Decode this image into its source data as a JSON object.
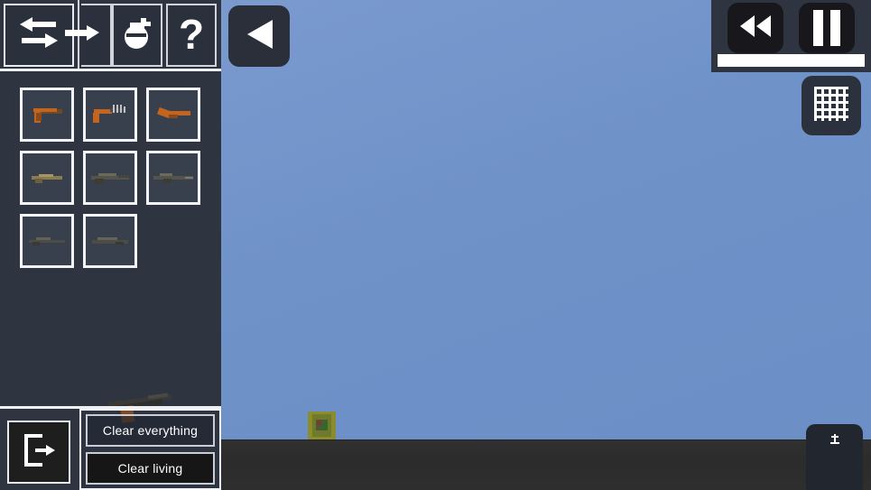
{
  "app": {
    "title": "Sandbox Weapon Spawner",
    "sky_color": "#6f92c9",
    "ground_color": "#2e2e2e",
    "panel_color": "#2e3440",
    "accent_color": "#f1f3f6"
  },
  "world": {
    "entity": {
      "name": "spawned-entity",
      "colors": {
        "body": "#8a8c2e",
        "shade": "#6f7a2a",
        "core": "#4c5b36",
        "dot_red": "#7a3b30",
        "dot_green": "#2f6a2c"
      }
    },
    "back_button": {
      "icon": "triangle-left-icon",
      "label": ""
    }
  },
  "sidebar": {
    "tabs": [
      {
        "icon": "swap-arrows-icon",
        "label": "",
        "selected": true,
        "name": "tab-swap"
      },
      {
        "icon": "arrow-right-icon",
        "label": "",
        "selected": false,
        "name": "tab-arrow-right"
      },
      {
        "icon": "grenade-icon",
        "label": "",
        "selected": false,
        "name": "tab-grenade"
      },
      {
        "icon": "question-mark-icon",
        "label": "",
        "selected": false,
        "name": "tab-help"
      }
    ],
    "weapons": [
      {
        "name": "weapon-slot-1",
        "kind": "pistol",
        "tint": "#c3651f"
      },
      {
        "name": "weapon-slot-2",
        "kind": "machine-pistol",
        "tint": "#c3651f"
      },
      {
        "name": "weapon-slot-3",
        "kind": "sawed-off",
        "tint": "#c3651f"
      },
      {
        "name": "weapon-slot-4",
        "kind": "smg",
        "tint": "#8a7a4e"
      },
      {
        "name": "weapon-slot-5",
        "kind": "assault-rifle",
        "tint": "#5a5a4a"
      },
      {
        "name": "weapon-slot-6",
        "kind": "carbine",
        "tint": "#55544a"
      },
      {
        "name": "weapon-slot-7",
        "kind": "sniper-rifle",
        "tint": "#4e4d45"
      },
      {
        "name": "weapon-slot-8",
        "kind": "battle-rifle",
        "tint": "#4e4d45"
      }
    ],
    "loose_weapon": {
      "name": "loose-weapon",
      "kind": "shotgun"
    },
    "exit_button": {
      "icon": "exit-door-icon",
      "label": ""
    },
    "actions": [
      {
        "name": "clear-everything-button",
        "label": "Clear everything",
        "style": "translucent"
      },
      {
        "name": "clear-living-button",
        "label": "Clear living",
        "style": "solid"
      }
    ]
  },
  "playback": {
    "rewind_button": {
      "icon": "rewind-icon",
      "label": ""
    },
    "pause_button": {
      "icon": "pause-icon",
      "label": ""
    },
    "timeline": {
      "name": "timeline-slider",
      "fill_percent": 100
    }
  },
  "grid_toggle": {
    "icon": "grid-icon",
    "label": ""
  },
  "bottom_right": {
    "icon": "anchor-icon",
    "label": ""
  }
}
